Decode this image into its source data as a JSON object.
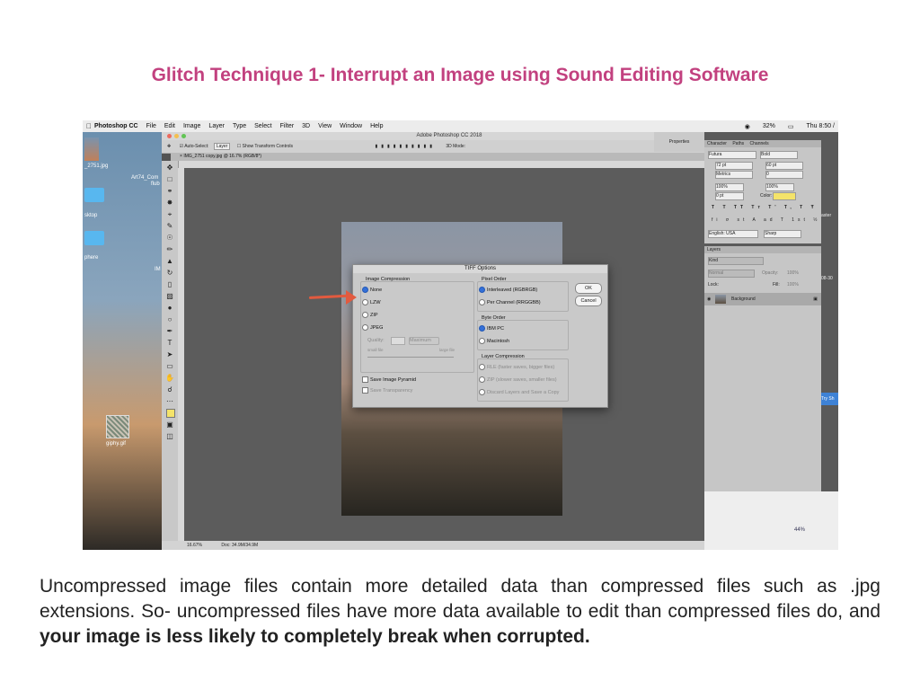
{
  "slide": {
    "title": "Glitch Technique 1- Interrupt an Image using Sound Editing Software",
    "caption_normal": "Uncompressed image files contain more detailed data than compressed files such as .jpg extensions. So- uncompressed files have more data available to edit than compressed files do, and ",
    "caption_bold": "your image is less likely to completely break when corrupted."
  },
  "menubar": {
    "app": "Photoshop CC",
    "items": [
      "File",
      "Edit",
      "Image",
      "Layer",
      "Type",
      "Select",
      "Filter",
      "3D",
      "View",
      "Window",
      "Help"
    ],
    "battery": "32%",
    "clock": "Thu 8:50 /"
  },
  "desktop": {
    "file1": "_2751.jpg",
    "file2": "Art74_Com",
    "file2b": "flub",
    "folder1": "sktop",
    "folder2": "phere",
    "gif": "giphy.gif",
    "im_label": "IM"
  },
  "photoshop": {
    "window_title": "Adobe Photoshop CC 2018",
    "options_autoselect": "Auto-Select:",
    "options_layer": "Layer",
    "options_transform": "Show Transform Controls",
    "options_3d": "3D Mode:",
    "doc_tab": "IMG_2751 copy.jpg @ 16.7% (RGB/8*)",
    "zoom": "16.67%",
    "doc_size": "Doc: 34.9M/34.9M",
    "properties": "Properties"
  },
  "dialog": {
    "title": "TIFF Options",
    "image_compression": "Image Compression",
    "opt_none": "None",
    "opt_lzw": "LZW",
    "opt_zip": "ZIP",
    "opt_jpeg": "JPEG",
    "quality_label": "Quality:",
    "quality_value": "Maximum",
    "small_file": "small file",
    "large_file": "large file",
    "pixel_order": "Pixel Order",
    "interleaved": "Interleaved (RGBRGB)",
    "per_channel": "Per Channel (RRGGBB)",
    "byte_order": "Byte Order",
    "ibm_pc": "IBM PC",
    "macintosh": "Macintosh",
    "layer_compression": "Layer Compression",
    "rle": "RLE (faster saves, bigger files)",
    "zip_layers": "ZIP (slower saves, smaller files)",
    "discard_layers": "Discard Layers and Save a Copy",
    "save_pyramid": "Save Image Pyramid",
    "save_transparency": "Save Transparency",
    "ok": "OK",
    "cancel": "Cancel"
  },
  "character_panel": {
    "tabs": [
      "Character",
      "Paths",
      "Channels"
    ],
    "font": "Futura",
    "style": "Bold",
    "size": "72 pt",
    "leading": "60 pt",
    "kerning": "Metrics",
    "tracking": "0",
    "vscale": "100%",
    "hscale": "100%",
    "baseline": "0 pt",
    "color_label": "Color:",
    "language": "English: USA",
    "antialias": "Sharp",
    "color": "#f4e36a"
  },
  "layers_panel": {
    "title": "Layers",
    "kind": "Kind",
    "blend": "Normal",
    "opacity_label": "Opacity:",
    "opacity": "100%",
    "lock_label": "Lock:",
    "fill_label": "Fill:",
    "fill": "100%",
    "layer_name": "Background"
  },
  "background_window": {
    "zoom": "44%",
    "label1": "08-30",
    "label2": "aster",
    "label3": "Try Sh"
  }
}
